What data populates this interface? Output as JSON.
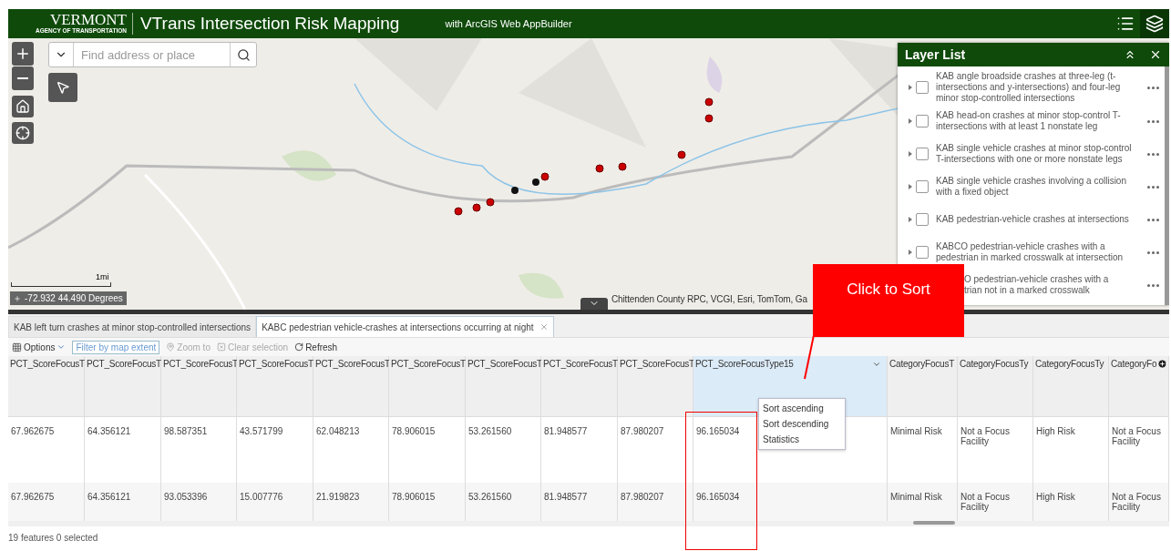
{
  "header": {
    "logo": {
      "name": "VERMONT",
      "agency": "AGENCY OF TRANSPORTATION"
    },
    "title": "VTrans Intersection Risk Mapping",
    "subtitle": "with ArcGIS Web AppBuilder",
    "tools": [
      {
        "kind": "list",
        "selected": false
      },
      {
        "kind": "layers",
        "selected": true
      }
    ]
  },
  "map": {
    "search": {
      "placeholder": "Find address or place"
    },
    "scale": "1mi",
    "coordinates": "-72.932 44.490 Degrees",
    "attribution": "Chittenden County RPC, VCGI, Esri, TomTom, Ga"
  },
  "layer_list": {
    "title": "Layer List",
    "layers": [
      {
        "label": "KAB angle broadside crashes at three-leg (t-intersections and y-intersections) and four-leg minor stop-controlled intersections",
        "checked": false,
        "covered": false
      },
      {
        "label": "KAB head-on crashes at minor stop-control T-intersections with at least 1 nonstate leg",
        "checked": false,
        "covered": false
      },
      {
        "label": "KAB single vehicle crashes at minor stop-control T-intersections with one or more nonstate legs",
        "checked": false,
        "covered": false
      },
      {
        "label": "KAB single vehicle crashes involving a collision with a fixed object",
        "checked": false,
        "covered": false
      },
      {
        "label": "KAB pedestrian-vehicle crashes at intersections",
        "checked": false,
        "covered": false
      },
      {
        "label": "KABCO pedestrian-vehicle crashes with a pedestrian in marked crosswalk at intersection",
        "checked": false,
        "covered": false
      },
      {
        "label": "O pedestrian-vehicle crashes with a trian not in a marked crosswalk",
        "covered": true
      }
    ]
  },
  "tabs": [
    {
      "label": "KAB left turn crashes at minor stop-controlled intersections",
      "selected": false
    },
    {
      "label": "KABC pedestrian vehicle-crashes at intersections occurring at night",
      "selected": true
    }
  ],
  "toolbar": {
    "options": "Options",
    "buttons": [
      {
        "kind": "filter",
        "label": "Filter by map extent",
        "disabled": false
      },
      {
        "kind": "zoom",
        "label": "Zoom to",
        "disabled": true
      },
      {
        "kind": "clear",
        "label": "Clear selection",
        "disabled": true
      },
      {
        "kind": "refresh",
        "label": "Refresh",
        "disabled": false
      }
    ]
  },
  "table": {
    "columns": [
      {
        "label": "PCT_ScoreFocusT",
        "selected": false
      },
      {
        "label": "PCT_ScoreFocusT",
        "selected": false
      },
      {
        "label": "PCT_ScoreFocusT",
        "selected": false
      },
      {
        "label": "PCT_ScoreFocusT",
        "selected": false
      },
      {
        "label": "PCT_ScoreFocusT",
        "selected": false
      },
      {
        "label": "PCT_ScoreFocusT",
        "selected": false
      },
      {
        "label": "PCT_ScoreFocusT",
        "selected": false
      },
      {
        "label": "PCT_ScoreFocusT",
        "selected": false
      },
      {
        "label": "PCT_ScoreFocusT",
        "selected": false
      },
      {
        "label": "PCT_ScoreFocusType15",
        "selected": true
      },
      {
        "label": "CategoryFocusT",
        "selected": false
      },
      {
        "label": "CategoryFocusTy",
        "selected": false
      },
      {
        "label": "CategoryFocusTy",
        "selected": false
      },
      {
        "label": "CategoryFo",
        "selected": false
      }
    ],
    "rows": [
      {
        "cells": [
          "67.962675",
          "64.356121",
          "98.587351",
          "43.571799",
          "62.048213",
          "78.906015",
          "53.261560",
          "81.948577",
          "87.980207",
          "96.165034",
          "Minimal Risk",
          "Not a Focus Facility",
          "High Risk",
          "Not a Focus Facility"
        ]
      },
      {
        "cells": [
          "67.962675",
          "64.356121",
          "93.053396",
          "15.007776",
          "21.919823",
          "78.906015",
          "53.261560",
          "81.948577",
          "87.980207",
          "96.165034",
          "Minimal Risk",
          "Not a Focus Facility",
          "High Risk",
          "Not a Focus Facility"
        ]
      }
    ],
    "column_menu": [
      "Sort ascending",
      "Sort descending",
      "Statistics"
    ]
  },
  "status": "19 features 0 selected",
  "annotation": {
    "text": "Click to Sort"
  }
}
